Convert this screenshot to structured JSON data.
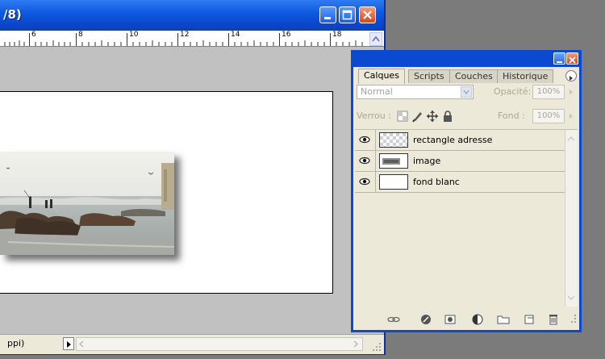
{
  "document": {
    "title": "/8)",
    "ruler_labels": [
      "6",
      "8",
      "10",
      "12",
      "14",
      "16",
      "18"
    ],
    "status_text": "ppi)"
  },
  "layers_panel": {
    "tabs": [
      {
        "label": "Calques",
        "active": true
      },
      {
        "label": "Scripts",
        "active": false
      },
      {
        "label": "Couches",
        "active": false
      },
      {
        "label": "Historique",
        "active": false
      }
    ],
    "blend_mode": "Normal",
    "opacity_label": "Opacité:",
    "opacity_value": "100%",
    "lock_label": "Verrou :",
    "fill_label": "Fond :",
    "fill_value": "100%",
    "layers": [
      {
        "name": "rectangle adresse",
        "thumbnail": "transparent-checker",
        "visible": true
      },
      {
        "name": "image",
        "thumbnail": "photo",
        "visible": true
      },
      {
        "name": "fond blanc",
        "thumbnail": "white",
        "visible": true
      }
    ]
  },
  "colors": {
    "xp_titlebar": "#0a49cf",
    "canvas_gray": "#c1c1c1",
    "panel_face": "#ece9d8",
    "close_button": "#d44a1a"
  }
}
